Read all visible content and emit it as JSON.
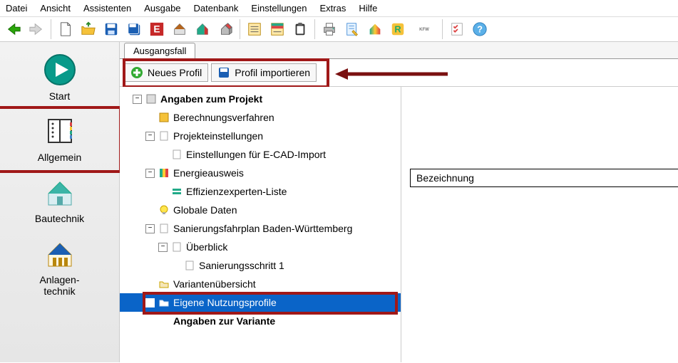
{
  "menu": [
    "Datei",
    "Ansicht",
    "Assistenten",
    "Ausgabe",
    "Datenbank",
    "Einstellungen",
    "Extras",
    "Hilfe"
  ],
  "sidebar": [
    {
      "label": "Start"
    },
    {
      "label": "Allgemein"
    },
    {
      "label": "Bautechnik"
    },
    {
      "label": "Anlagen-\ntechnik"
    }
  ],
  "tab": "Ausgangsfall",
  "profileButtons": {
    "new": "Neues Profil",
    "import": "Profil importieren"
  },
  "tree": {
    "n0": "Angaben zum Projekt",
    "n1": "Berechnungsverfahren",
    "n2": "Projekteinstellungen",
    "n3": "Einstellungen für E-CAD-Import",
    "n4": "Energieausweis",
    "n5": "Effizienzexperten-Liste",
    "n6": "Globale Daten",
    "n7": "Sanierungsfahrplan Baden-Württemberg",
    "n8": "Überblick",
    "n9": "Sanierungsschritt 1",
    "n10": "Variantenübersicht",
    "n11": "Eigene Nutzungsprofile",
    "n12": "Angaben zur Variante"
  },
  "rightHeader": "Bezeichnung",
  "colors": {
    "highlight": "#a01818",
    "selection": "#0a64c8"
  }
}
